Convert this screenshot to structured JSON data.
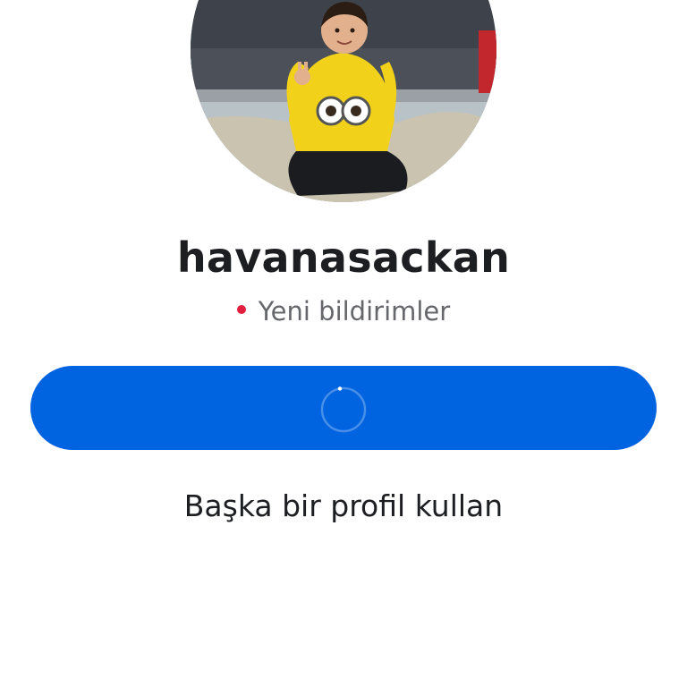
{
  "profile": {
    "username": "havanasackan",
    "notification_text": "Yeni bildirimler"
  },
  "actions": {
    "continue_button_label": "",
    "other_profile_label": "Başka bir profil kullan"
  },
  "colors": {
    "primary_button": "#0064e0",
    "notification_dot": "#e41e3f",
    "username_text": "#1c1e21",
    "secondary_text": "#65676b"
  },
  "icons": {
    "avatar": "profile-photo",
    "spinner": "loading-spinner-icon",
    "notification_dot": "red-dot-icon"
  }
}
